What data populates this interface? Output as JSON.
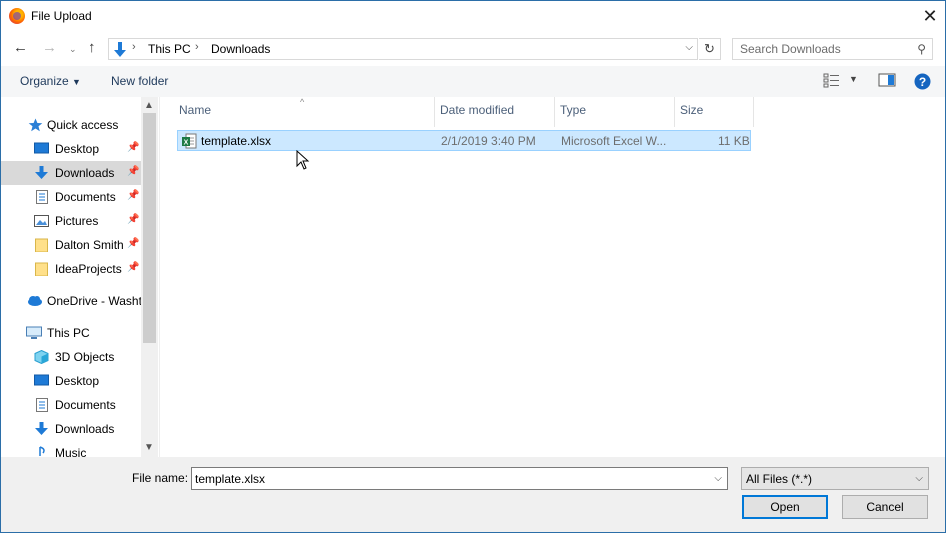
{
  "window": {
    "title": "File Upload",
    "close_label": "✕"
  },
  "address": {
    "crumbs": [
      "This PC",
      "Downloads"
    ],
    "search_placeholder": "Search Downloads"
  },
  "toolbar": {
    "organize": "Organize",
    "new_folder": "New folder"
  },
  "nav": {
    "items": [
      {
        "label": "Quick access"
      },
      {
        "label": "Desktop"
      },
      {
        "label": "Downloads"
      },
      {
        "label": "Documents"
      },
      {
        "label": "Pictures"
      },
      {
        "label": "Dalton Smith"
      },
      {
        "label": "IdeaProjects"
      },
      {
        "label": "OneDrive - Washt"
      },
      {
        "label": "This PC"
      },
      {
        "label": "3D Objects"
      },
      {
        "label": "Desktop"
      },
      {
        "label": "Documents"
      },
      {
        "label": "Downloads"
      },
      {
        "label": "Music"
      }
    ]
  },
  "columns": {
    "name": "Name",
    "date": "Date modified",
    "type": "Type",
    "size": "Size"
  },
  "files": [
    {
      "name": "template.xlsx",
      "date": "2/1/2019 3:40 PM",
      "type": "Microsoft Excel W...",
      "size": "11 KB"
    }
  ],
  "bottom": {
    "file_name_label": "File name:",
    "file_name_value": "template.xlsx",
    "filter_value": "All Files (*.*)",
    "open": "Open",
    "cancel": "Cancel"
  },
  "colors": {
    "selection": "#cce8ff",
    "accent": "#0078d7",
    "border": "#2b6ea8"
  }
}
